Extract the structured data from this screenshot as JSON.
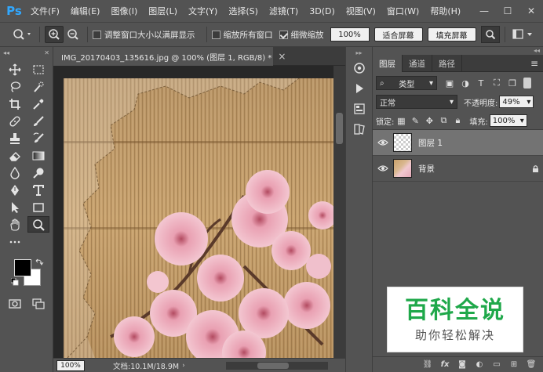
{
  "app": {
    "logo": "Ps"
  },
  "menu": [
    "文件(F)",
    "编辑(E)",
    "图像(I)",
    "图层(L)",
    "文字(Y)",
    "选择(S)",
    "滤镜(T)",
    "3D(D)",
    "视图(V)",
    "窗口(W)",
    "帮助(H)"
  ],
  "window_controls": {
    "minimize": "—",
    "maximize": "☐",
    "close": "✕"
  },
  "options": {
    "resize_windows_label": "调整窗口大小以满屏显示",
    "resize_windows_checked": false,
    "zoom_all_label": "缩放所有窗口",
    "zoom_all_checked": false,
    "scrubby_label": "细微缩放",
    "scrubby_checked": true,
    "zoom_value": "100%",
    "fit_screen_label": "适合屏幕",
    "fill_screen_label": "填充屏幕"
  },
  "document": {
    "tab_title": "IMG_20170403_135616.jpg @ 100% (图层 1, RGB/8) *",
    "close": "×"
  },
  "status": {
    "zoom": "100%",
    "doc_info": "文档:10.1M/18.9M"
  },
  "panel": {
    "tabs": [
      "图层",
      "通道",
      "路径"
    ],
    "active_tab": "图层",
    "filter_kind": "类型",
    "blend_mode": "正常",
    "opacity_label": "不透明度:",
    "opacity_value": "49%",
    "lock_label": "锁定:",
    "fill_label": "填充:",
    "fill_value": "100%",
    "layers": [
      {
        "name": "图层 1",
        "selected": true,
        "visible": true,
        "locked": false,
        "thumb": "transparent"
      },
      {
        "name": "背景",
        "selected": false,
        "visible": true,
        "locked": true,
        "thumb": "photo"
      }
    ],
    "footer_fx": "fx"
  },
  "watermark": {
    "title": "百科全说",
    "subtitle": "助你轻松解决"
  },
  "colors": {
    "ui_bg": "#535353",
    "panel_dark": "#3c3c3c",
    "selected_layer": "#737373",
    "watermark_green": "#1fa84a",
    "ps_blue": "#31a8ff"
  }
}
